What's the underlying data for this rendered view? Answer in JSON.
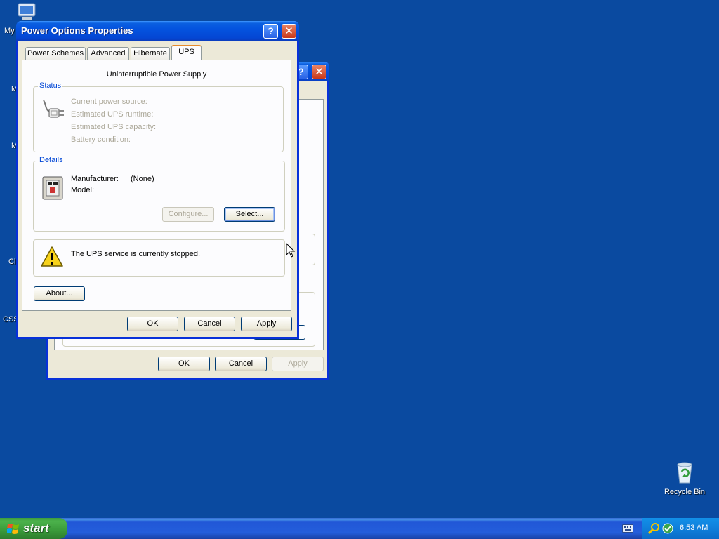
{
  "desktop": {
    "icons": [
      {
        "label": "My",
        "icon": "my-computer-icon"
      },
      {
        "label": "M"
      },
      {
        "label": "M"
      },
      {
        "label": "Cl"
      },
      {
        "label": "CSS"
      }
    ],
    "recycle_bin": {
      "label": "Recycle Bin",
      "icon": "recycle-bin-icon"
    }
  },
  "back_window": {
    "buttons": {
      "ok": "OK",
      "cancel": "Cancel",
      "apply": "Apply"
    }
  },
  "dialog": {
    "title": "Power Options Properties",
    "tabs": [
      {
        "label": "Power Schemes",
        "active": false
      },
      {
        "label": "Advanced",
        "active": false
      },
      {
        "label": "Hibernate",
        "active": false
      },
      {
        "label": "UPS",
        "active": true
      }
    ],
    "ups": {
      "heading": "Uninterruptible Power Supply",
      "status": {
        "label": "Status",
        "lines": [
          "Current power source:",
          "Estimated UPS runtime:",
          "Estimated UPS capacity:",
          "Battery condition:"
        ]
      },
      "details": {
        "label": "Details",
        "manufacturer_label": "Manufacturer:",
        "manufacturer_value": "(None)",
        "model_label": "Model:",
        "configure": "Configure...",
        "select": "Select..."
      },
      "warning": "The UPS service is currently stopped.",
      "about": "About..."
    },
    "buttons": {
      "ok": "OK",
      "cancel": "Cancel",
      "apply": "Apply"
    }
  },
  "taskbar": {
    "start": "start",
    "clock": "6:53 AM"
  },
  "colors": {
    "desktop": "#0a4aa0",
    "titlebar": "#0453df",
    "group_label": "#0046d5",
    "tab_highlight": "#e68b2c"
  }
}
